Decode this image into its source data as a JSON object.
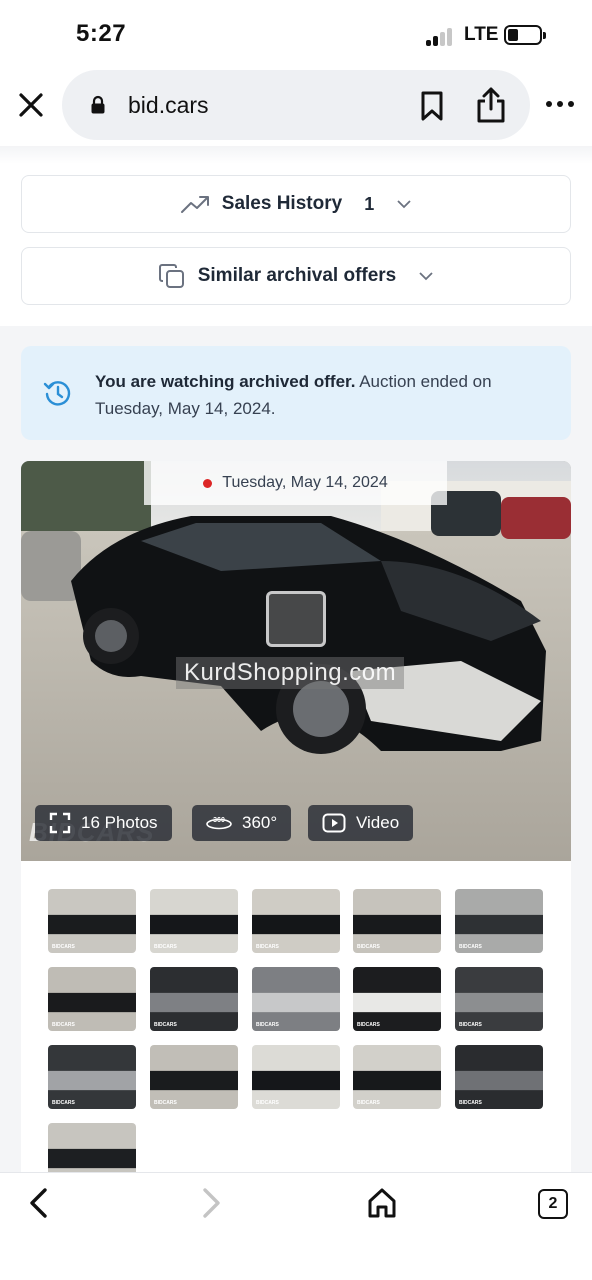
{
  "status_bar": {
    "time": "5:27",
    "network": "LTE"
  },
  "browser": {
    "url": "bid.cars"
  },
  "accordions": {
    "sales_history": {
      "label": "Sales History",
      "count": "1"
    },
    "similar_offers": {
      "label": "Similar archival offers"
    }
  },
  "notice": {
    "bold": "You are watching archived offer.",
    "rest": " Auction ended on Tuesday, May 14, 2024."
  },
  "photo": {
    "date": "Tuesday, May 14, 2024",
    "watermark": "KurdShopping.com",
    "brand_mark": "BIDCARS",
    "buttons": {
      "photos": "16 Photos",
      "pano": "360°",
      "video": "Video"
    }
  },
  "thumbnails": [
    {
      "kind": "ext-front"
    },
    {
      "kind": "ext-side"
    },
    {
      "kind": "ext-rear"
    },
    {
      "kind": "ext-rear2"
    },
    {
      "kind": "interior"
    },
    {
      "kind": "ext-front2"
    },
    {
      "kind": "dash"
    },
    {
      "kind": "seats"
    },
    {
      "kind": "label"
    },
    {
      "kind": "engine"
    },
    {
      "kind": "console"
    },
    {
      "kind": "ext-front3"
    },
    {
      "kind": "ext-side2"
    },
    {
      "kind": "ext-side3"
    },
    {
      "kind": "dash2"
    },
    {
      "kind": "ext-lot"
    }
  ],
  "thumb_label": "BIDCARS",
  "bottom_nav": {
    "tabs_count": "2"
  }
}
